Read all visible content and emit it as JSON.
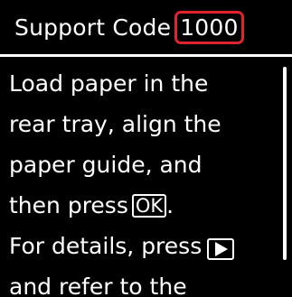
{
  "header": {
    "title": "Support Code",
    "code": "1000",
    "code_highlight_color": "#e0242b"
  },
  "message": {
    "lines": [
      "Load paper in the",
      "rear tray, align the",
      "paper guide, and",
      "then press",
      "For details, press",
      "and refer to the"
    ],
    "line4_suffix": ".",
    "ok_key_label": "OK",
    "next_key_icon": "play-right-icon"
  },
  "colors": {
    "background": "#000000",
    "text": "#ffffff"
  }
}
